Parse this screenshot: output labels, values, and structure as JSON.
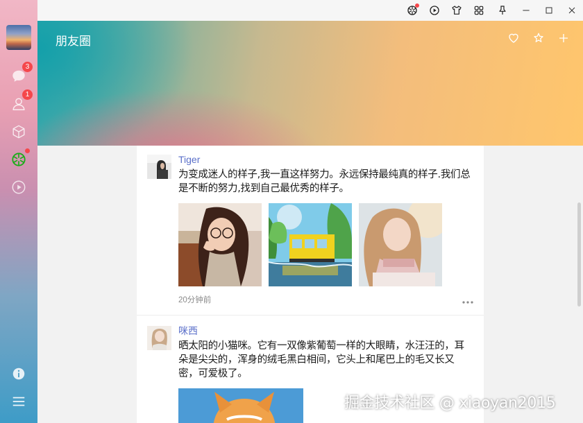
{
  "app": {
    "page_title": "朋友圈"
  },
  "sidebar": {
    "items": [
      {
        "name": "chat",
        "icon": "chat-bubble-icon",
        "badge": "3"
      },
      {
        "name": "contacts",
        "icon": "person-icon",
        "badge": "1"
      },
      {
        "name": "favorites",
        "icon": "cube-icon",
        "badge": ""
      },
      {
        "name": "moments",
        "icon": "aperture-icon",
        "dot": true
      },
      {
        "name": "channels",
        "icon": "play-circle-icon",
        "badge": ""
      }
    ],
    "bottom": [
      {
        "name": "info",
        "icon": "info-icon"
      },
      {
        "name": "menu",
        "icon": "hamburger-menu-icon"
      }
    ]
  },
  "titlebar": {
    "icons": [
      "aperture-icon",
      "play-circle-icon",
      "shirt-icon",
      "grid-icon",
      "pin-icon",
      "minimize-icon",
      "maximize-icon",
      "close-icon"
    ]
  },
  "banner": {
    "icons": [
      "heart-icon",
      "sparkle-icon",
      "plus-icon"
    ]
  },
  "feed": {
    "posts": [
      {
        "name": "Tiger",
        "text": "为变成迷人的样子,我一直这样努力。永远保持最纯真的样子.我们总是不断的努力,找到自己最优秀的样子。",
        "time": "20分钟前"
      },
      {
        "name": "咪西",
        "text": "晒太阳的小猫咪。它有一双像紫葡萄一样的大眼睛，水汪汪的，耳朵是尖尖的，浑身的绒毛黑白相间，它头上和尾巴上的毛又长又密，可爱极了。"
      }
    ]
  },
  "colors": {
    "accent_name": "#5a6fc9",
    "badge": "#f5474b",
    "moments_icon": "#1aad19"
  },
  "watermark": "掘金技术社区 @ xiaoyan2015"
}
